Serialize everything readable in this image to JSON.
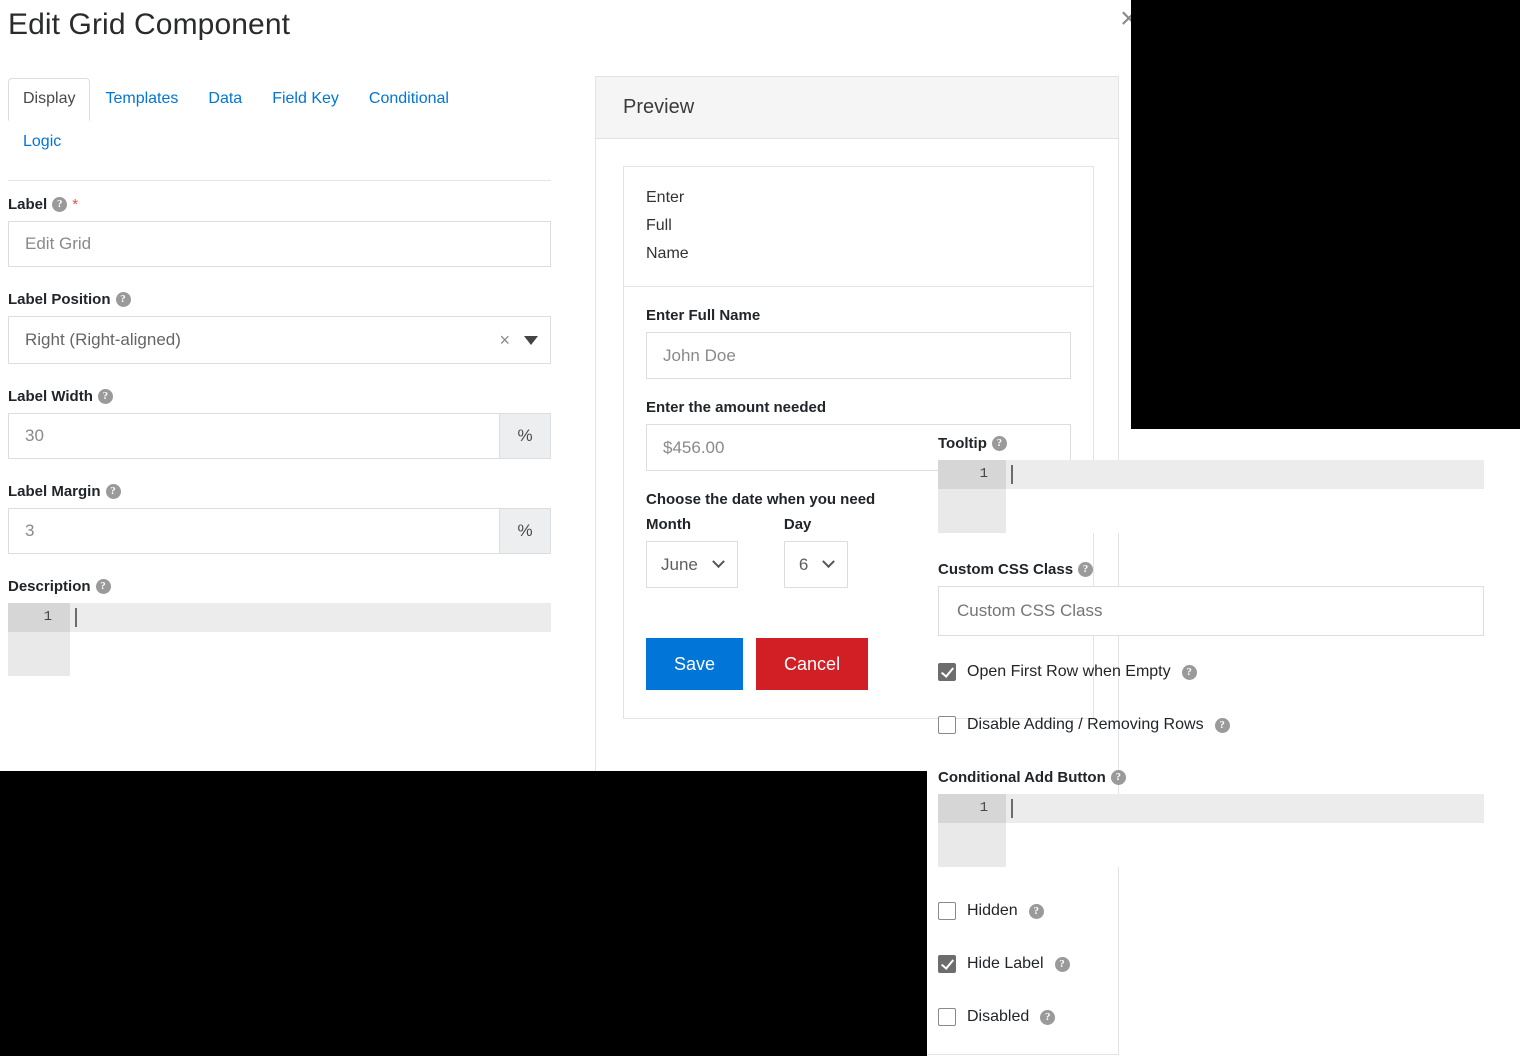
{
  "window": {
    "title": "Edit Grid Component",
    "close_label": "×"
  },
  "tabs": [
    {
      "label": "Display",
      "active": true
    },
    {
      "label": "Templates",
      "active": false
    },
    {
      "label": "Data",
      "active": false
    },
    {
      "label": "Field Key",
      "active": false
    },
    {
      "label": "Conditional",
      "active": false
    },
    {
      "label": "Logic",
      "active": false
    }
  ],
  "settings": {
    "label": {
      "title": "Label",
      "required_mark": "*",
      "value": "Edit Grid"
    },
    "label_position": {
      "title": "Label Position",
      "value": "Right (Right-aligned)",
      "clear_glyph": "×"
    },
    "label_width": {
      "title": "Label Width",
      "value": "30",
      "unit": "%"
    },
    "label_margin": {
      "title": "Label Margin",
      "value": "3",
      "unit": "%"
    },
    "description": {
      "title": "Description",
      "line_number": "1",
      "value": ""
    },
    "tooltip": {
      "title": "Tooltip",
      "line_number": "1",
      "value": ""
    },
    "custom_css_class": {
      "title": "Custom CSS Class",
      "placeholder": "Custom CSS Class",
      "value": ""
    },
    "conditional_add_button": {
      "title": "Conditional Add Button",
      "line_number": "1",
      "value": ""
    },
    "checkboxes": [
      {
        "label": "Open First Row when Empty",
        "checked": true
      },
      {
        "label": "Disable Adding / Removing Rows",
        "checked": false
      },
      {
        "label": "Hidden",
        "checked": false
      },
      {
        "label": "Hide Label",
        "checked": true
      },
      {
        "label": "Disabled",
        "checked": false
      }
    ]
  },
  "preview": {
    "header": "Preview",
    "grid_header_cell": "Enter\nFull\nName",
    "grid_header_lines": [
      "Enter",
      "Full",
      "Name"
    ],
    "fields": [
      {
        "label": "Enter Full Name",
        "value": "John Doe"
      },
      {
        "label": "Enter the amount needed",
        "value": "$456.00"
      }
    ],
    "date_section": {
      "label": "Choose the date when you need",
      "month": {
        "label": "Month",
        "value": "June"
      },
      "day": {
        "label": "Day",
        "value": "6"
      }
    },
    "buttons": {
      "save": "Save",
      "cancel": "Cancel"
    }
  },
  "colors": {
    "link": "#0275d8",
    "save": "#0275d8",
    "cancel": "#d11f25",
    "required": "#d9534f"
  }
}
